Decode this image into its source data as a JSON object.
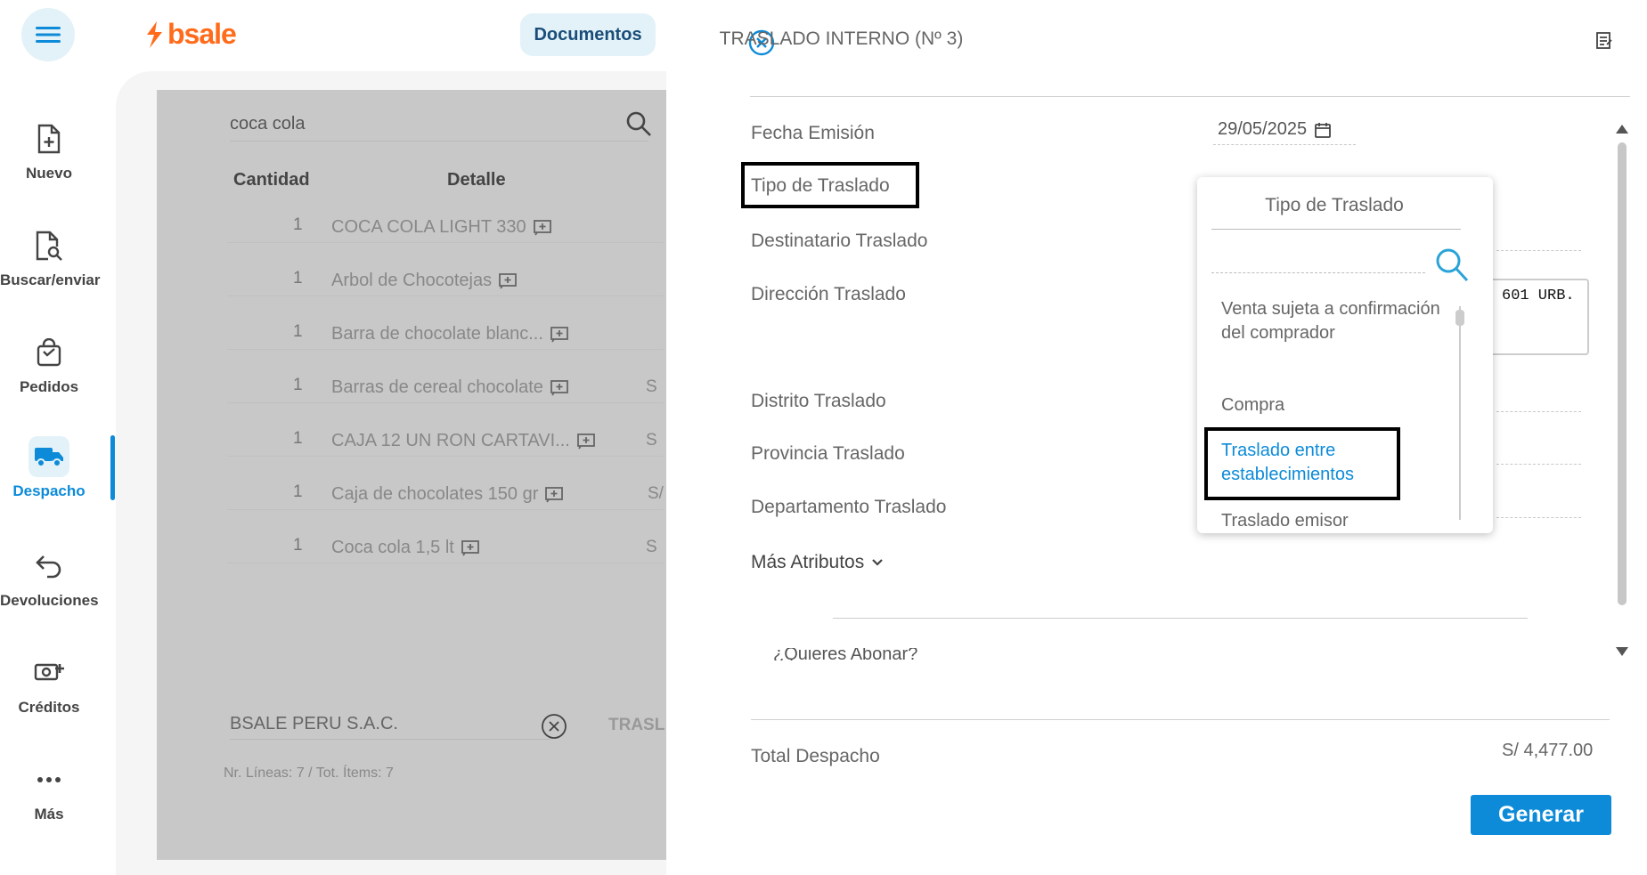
{
  "brand": {
    "name": "bsale",
    "color": "#ff6b1a"
  },
  "accent_color": "#0d8bd8",
  "header": {
    "documents_tab": "Documentos"
  },
  "nav": {
    "items": [
      {
        "label": "Nuevo",
        "icon": "file-plus-icon"
      },
      {
        "label": "Buscar/enviar",
        "icon": "file-search-icon"
      },
      {
        "label": "Pedidos",
        "icon": "shopping-bag-icon"
      },
      {
        "label": "Despacho",
        "icon": "truck-icon",
        "active": true
      },
      {
        "label": "Devoluciones",
        "icon": "return-arrow-icon"
      },
      {
        "label": "Créditos",
        "icon": "cash-plus-icon"
      },
      {
        "label": "Más",
        "icon": "more-dots-icon"
      }
    ]
  },
  "sale": {
    "search_value": "coca cola",
    "columns": {
      "quantity": "Cantidad",
      "detail": "Detalle"
    },
    "rows": [
      {
        "qty": "1",
        "detail": "COCA COLA LIGHT 330",
        "price": ""
      },
      {
        "qty": "1",
        "detail": "Arbol de Chocotejas",
        "price": ""
      },
      {
        "qty": "1",
        "detail": "Barra de chocolate blanc...",
        "price": ""
      },
      {
        "qty": "1",
        "detail": "Barras de cereal chocolate",
        "price": "S"
      },
      {
        "qty": "1",
        "detail": "CAJA 12 UN RON CARTAVI...",
        "price": "S"
      },
      {
        "qty": "1",
        "detail": "Caja de chocolates 150 gr",
        "price": "S/"
      },
      {
        "qty": "1",
        "detail": "Coca cola 1,5 lt",
        "price": "S"
      }
    ],
    "client": "BSALE PERU S.A.C.",
    "doc_type_partial": "TRASL",
    "footer": "Nr. Líneas: 7 / Tot. Ítems: 7"
  },
  "modal": {
    "title": "TRASLADO INTERNO (Nº 3)",
    "fields": {
      "fecha_label": "Fecha Emisión",
      "fecha_value": "29/05/2025",
      "tipo_label": "Tipo de Traslado",
      "destinatario_label": "Destinatario Traslado",
      "direccion_label": "Dirección Traslado",
      "direccion_value": "601 URB.",
      "distrito_label": "Distrito Traslado",
      "provincia_label": "Provincia Traslado",
      "departamento_label": "Departamento Traslado"
    },
    "more_attributes": "Más Atributos",
    "abonar": "¿Quieres Abonar?",
    "total_label": "Total Despacho",
    "total_value": "S/ 4,477.00",
    "generate_button": "Generar"
  },
  "dropdown": {
    "title": "Tipo de Traslado",
    "options": [
      {
        "label": "Venta sujeta a confirmación del comprador"
      },
      {
        "label": "Compra"
      },
      {
        "label": "Traslado entre establecimientos",
        "selected": true
      },
      {
        "label": "Traslado emisor"
      }
    ]
  }
}
